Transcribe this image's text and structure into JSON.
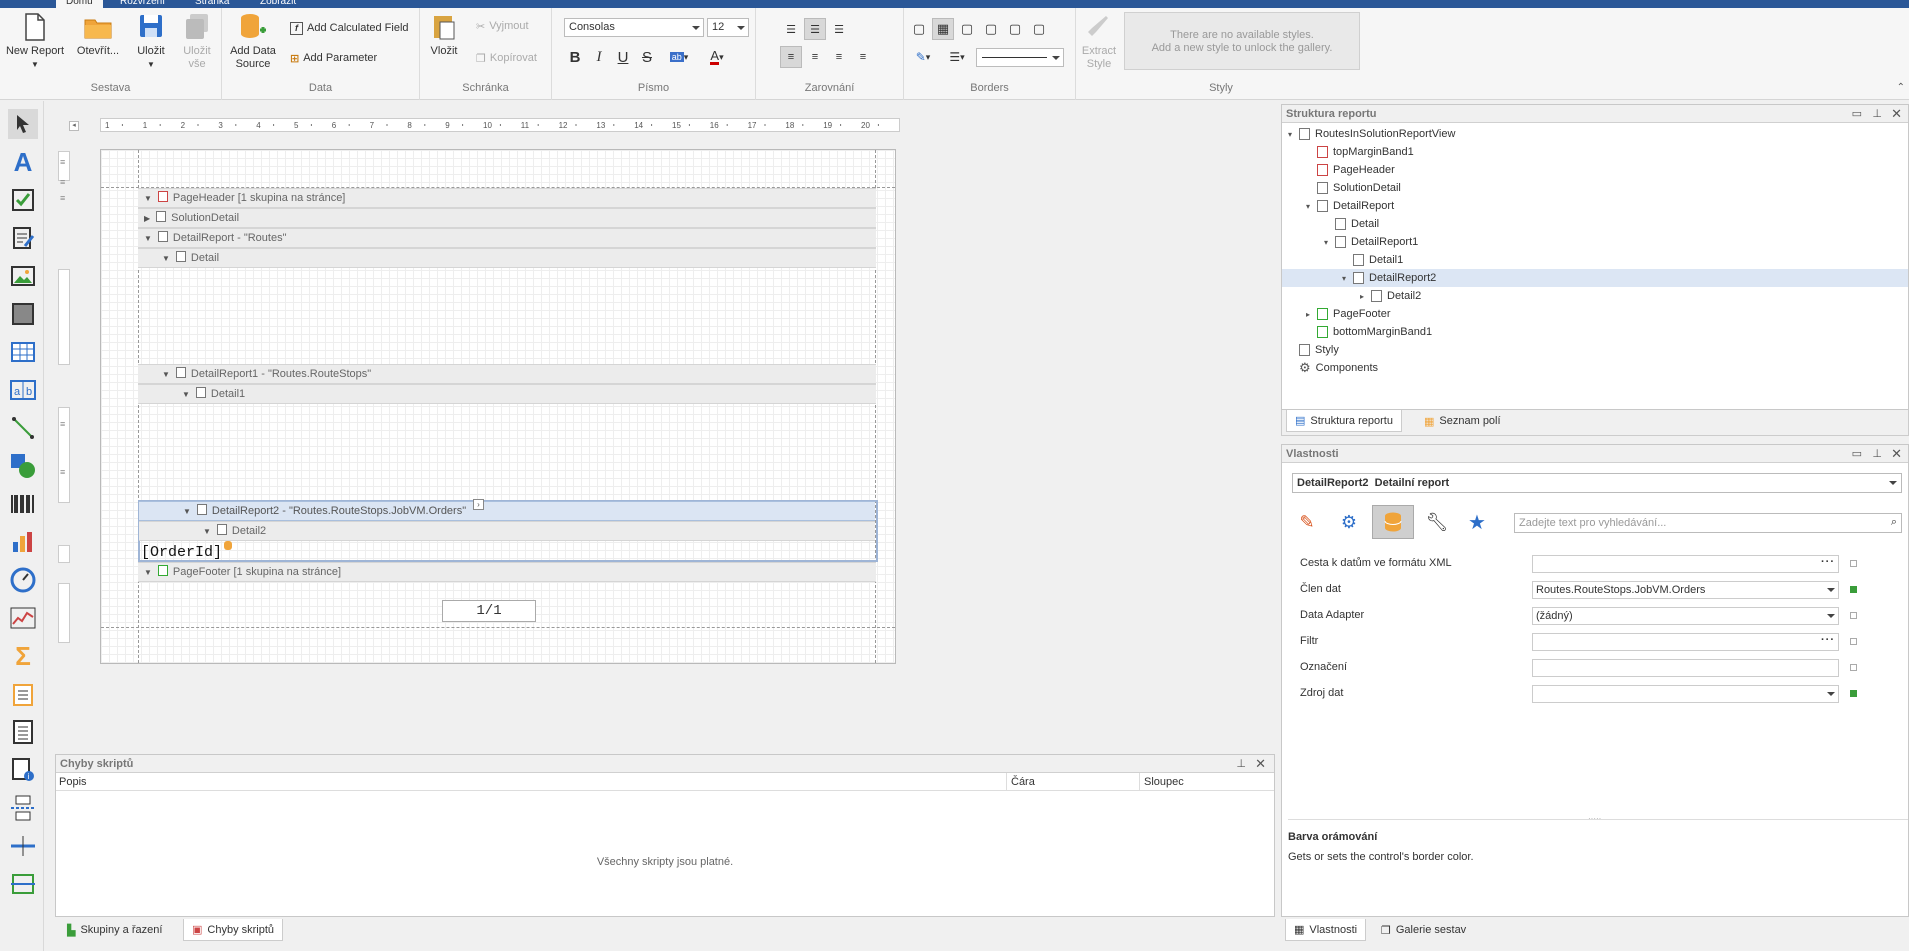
{
  "ribbon": {
    "tabs": [
      "Domů",
      "Rozvržení",
      "Stránka",
      "Zobrazit"
    ],
    "groups": {
      "sestava": {
        "caption": "Sestava",
        "new_report": "New Report",
        "open": "Otevřít...",
        "save": "Uložit",
        "save_all": "Uložit vše"
      },
      "data": {
        "caption": "Data",
        "add_data_source": "Add Data Source",
        "add_calc_field": "Add Calculated Field",
        "add_parameter": "Add Parameter"
      },
      "schranka": {
        "caption": "Schránka",
        "paste": "Vložit",
        "cut": "Vyjmout",
        "copy": "Kopírovat"
      },
      "pismo": {
        "caption": "Písmo",
        "font_name": "Consolas",
        "font_size": "12"
      },
      "zarovnani": {
        "caption": "Zarovnání"
      },
      "borders": {
        "caption": "Borders"
      },
      "styly": {
        "caption": "Styly",
        "extract_style": "Extract Style",
        "gallery_line1": "There are no available styles.",
        "gallery_line2": "Add a new style to unlock the gallery."
      }
    }
  },
  "design": {
    "ruler_numbers": [
      "1",
      "1",
      "2",
      "3",
      "4",
      "5",
      "6",
      "7",
      "8",
      "9",
      "10",
      "11",
      "12",
      "13",
      "14",
      "15",
      "16",
      "17",
      "18",
      "19",
      "20"
    ],
    "bands": [
      {
        "label": "PageHeader [1 skupina na stránce]"
      },
      {
        "label": "SolutionDetail"
      },
      {
        "label": "DetailReport - \"Routes\""
      },
      {
        "label": "Detail"
      },
      {
        "label": "DetailReport1 - \"Routes.RouteStops\""
      },
      {
        "label": "Detail1"
      },
      {
        "label": "DetailReport2 - \"Routes.RouteStops.JobVM.Orders\""
      },
      {
        "label": "Detail2"
      },
      {
        "label": "PageFooter [1 skupina na stránce]"
      }
    ],
    "orderid_field": "[OrderId]",
    "page_info": "1/1"
  },
  "structure": {
    "title": "Struktura reportu",
    "items": [
      {
        "label": "RoutesInSolutionReportView"
      },
      {
        "label": "topMarginBand1"
      },
      {
        "label": "PageHeader"
      },
      {
        "label": "SolutionDetail"
      },
      {
        "label": "DetailReport"
      },
      {
        "label": "Detail"
      },
      {
        "label": "DetailReport1"
      },
      {
        "label": "Detail1"
      },
      {
        "label": "DetailReport2"
      },
      {
        "label": "Detail2"
      },
      {
        "label": "PageFooter"
      },
      {
        "label": "bottomMarginBand1"
      },
      {
        "label": "Styly"
      },
      {
        "label": "Components"
      }
    ],
    "tabs": [
      "Struktura reportu",
      "Seznam polí"
    ]
  },
  "properties": {
    "title": "Vlastnosti",
    "selected_name": "DetailReport2",
    "selected_type": "Detailní report",
    "search_placeholder": "Zadejte text pro vyhledávání...",
    "rows": [
      {
        "label": "Cesta k datům ve formátu XML",
        "value": ""
      },
      {
        "label": "Člen dat",
        "value": "Routes.RouteStops.JobVM.Orders"
      },
      {
        "label": "Data Adapter",
        "value": "(žádný)"
      },
      {
        "label": "Filtr",
        "value": ""
      },
      {
        "label": "Označení",
        "value": ""
      },
      {
        "label": "Zdroj dat",
        "value": ""
      }
    ],
    "desc_title": "Barva orámování",
    "desc_text": "Gets or sets the control's border color.",
    "tabs": [
      "Vlastnosti",
      "Galerie sestav"
    ]
  },
  "errors": {
    "title": "Chyby skriptů",
    "columns": [
      "Popis",
      "Čára",
      "Sloupec"
    ],
    "empty_message": "Všechny skripty jsou platné.",
    "tabs": [
      "Skupiny a řazení",
      "Chyby skriptů"
    ]
  }
}
